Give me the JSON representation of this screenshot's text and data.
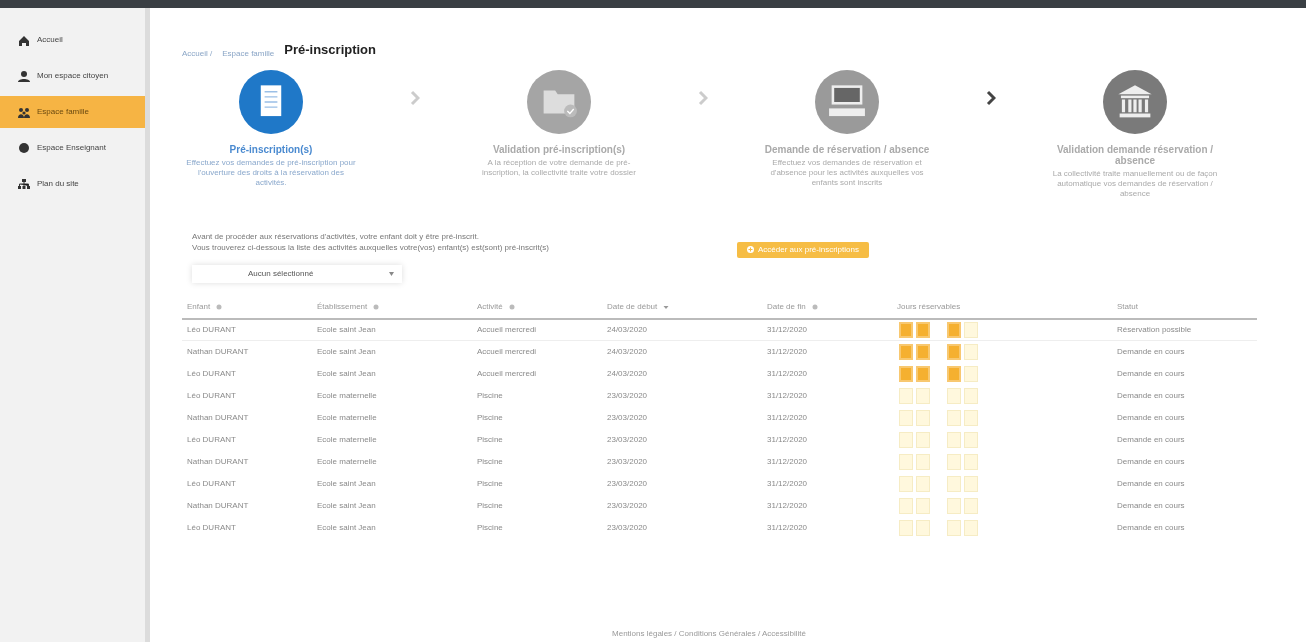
{
  "sidebar": {
    "items": [
      {
        "label": "Accueil",
        "selected": false
      },
      {
        "label": "Mon espace citoyen",
        "selected": false
      },
      {
        "label": "Espace famille",
        "selected": true
      },
      {
        "label": "Espace Enseignant",
        "selected": false
      },
      {
        "label": "Plan du site",
        "selected": false
      }
    ]
  },
  "breadcrumb": [
    "Accueil /",
    "Espace famille",
    "Pré-inscription"
  ],
  "steps": [
    {
      "title": "Pré-inscription(s)",
      "description": "Effectuez vos demandes de pré-inscription pour l'ouverture des droits à la réservation des activités.",
      "active": true
    },
    {
      "title": "Validation pré-inscription(s)",
      "description": "A la réception de votre demande de pré-inscription, la collectivité traite votre dossier",
      "active": false
    },
    {
      "title": "Demande de réservation / absence",
      "description": "Effectuez vos demandes de réservation et d'absence pour les activités auxquelles vos enfants sont inscrits",
      "active": false
    },
    {
      "title": "Validation demande réservation / absence",
      "description": "La collectivité traite manuellement ou de façon automatique vos demandes de réservation / absence",
      "active": false
    }
  ],
  "arrows": [
    {
      "dark": false
    },
    {
      "dark": false
    },
    {
      "dark": true
    }
  ],
  "info": [
    "Avant de procéder aux réservations d'activités, votre enfant doit y être pré-inscrit.",
    "Vous trouverez ci-dessous la liste des activités auxquelles votre(vos) enfant(s) est(sont) pré-inscrit(s)"
  ],
  "action_button": "Accéder aux pré-inscriptions",
  "filter": {
    "value": "Aucun sélectionné"
  },
  "table": {
    "columns": [
      "Enfant",
      "Établissement",
      "Activité",
      "Date de début",
      "Date de fin",
      "Jours réservables",
      "Statut"
    ],
    "rows": [
      {
        "child": "Léo DURANT",
        "school": "Ecole saint Jean",
        "activity": "Accueil mercredi",
        "start": "24/03/2020",
        "end": "31/12/2020",
        "days": [
          {
            "selected": true
          },
          {
            "selected": true
          },
          {
            "selected": true
          },
          {
            "selected": false
          }
        ],
        "status": "Réservation possible"
      },
      {
        "child": "Nathan DURANT",
        "school": "Ecole saint Jean",
        "activity": "Accueil mercredi",
        "start": "24/03/2020",
        "end": "31/12/2020",
        "days": [
          {
            "selected": true
          },
          {
            "selected": true
          },
          {
            "selected": true
          },
          {
            "selected": false
          }
        ],
        "status": "Demande en cours"
      },
      {
        "child": "Léo DURANT",
        "school": "Ecole saint Jean",
        "activity": "Accueil mercredi",
        "start": "24/03/2020",
        "end": "31/12/2020",
        "days": [
          {
            "selected": true
          },
          {
            "selected": true
          },
          {
            "selected": true
          },
          {
            "selected": false
          }
        ],
        "status": "Demande en cours"
      },
      {
        "child": "Léo DURANT",
        "school": "Ecole maternelle",
        "activity": "Piscine",
        "start": "23/03/2020",
        "end": "31/12/2020",
        "days": [
          {
            "selected": false
          },
          {
            "selected": false
          },
          {
            "selected": false
          },
          {
            "selected": false
          }
        ],
        "status": "Demande en cours"
      },
      {
        "child": "Nathan DURANT",
        "school": "Ecole maternelle",
        "activity": "Piscine",
        "start": "23/03/2020",
        "end": "31/12/2020",
        "days": [
          {
            "selected": false
          },
          {
            "selected": false
          },
          {
            "selected": false
          },
          {
            "selected": false
          }
        ],
        "status": "Demande en cours"
      },
      {
        "child": "Léo DURANT",
        "school": "Ecole maternelle",
        "activity": "Piscine",
        "start": "23/03/2020",
        "end": "31/12/2020",
        "days": [
          {
            "selected": false
          },
          {
            "selected": false
          },
          {
            "selected": false
          },
          {
            "selected": false
          }
        ],
        "status": "Demande en cours"
      },
      {
        "child": "Nathan DURANT",
        "school": "Ecole maternelle",
        "activity": "Piscine",
        "start": "23/03/2020",
        "end": "31/12/2020",
        "days": [
          {
            "selected": false
          },
          {
            "selected": false
          },
          {
            "selected": false
          },
          {
            "selected": false
          }
        ],
        "status": "Demande en cours"
      },
      {
        "child": "Léo DURANT",
        "school": "Ecole saint Jean",
        "activity": "Piscine",
        "start": "23/03/2020",
        "end": "31/12/2020",
        "days": [
          {
            "selected": false
          },
          {
            "selected": false
          },
          {
            "selected": false
          },
          {
            "selected": false
          }
        ],
        "status": "Demande en cours"
      },
      {
        "child": "Nathan DURANT",
        "school": "Ecole saint Jean",
        "activity": "Piscine",
        "start": "23/03/2020",
        "end": "31/12/2020",
        "days": [
          {
            "selected": false
          },
          {
            "selected": false
          },
          {
            "selected": false
          },
          {
            "selected": false
          }
        ],
        "status": "Demande en cours"
      },
      {
        "child": "Léo DURANT",
        "school": "Ecole saint Jean",
        "activity": "Piscine",
        "start": "23/03/2020",
        "end": "31/12/2020",
        "days": [
          {
            "selected": false
          },
          {
            "selected": false
          },
          {
            "selected": false
          },
          {
            "selected": false
          }
        ],
        "status": "Demande en cours"
      }
    ]
  },
  "footer": "Mentions légales / Conditions Générales / Accessibilité"
}
